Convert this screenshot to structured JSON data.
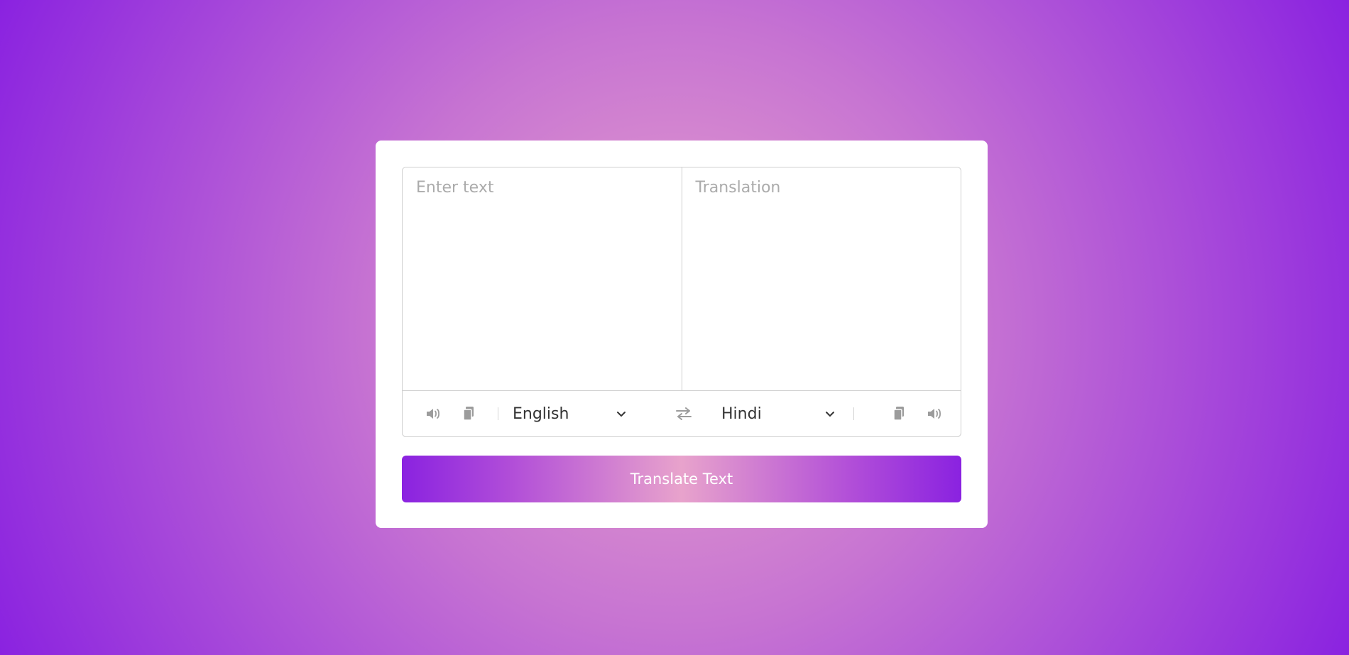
{
  "from_text": {
    "placeholder": "Enter text",
    "value": ""
  },
  "to_text": {
    "placeholder": "Translation",
    "value": ""
  },
  "controls": {
    "from_language": "English",
    "to_language": "Hindi",
    "icons": {
      "speak": "volume-icon",
      "copy": "copy-icon",
      "exchange": "exchange-icon",
      "dropdown": "chevron-down-icon"
    }
  },
  "translate_button": {
    "label": "Translate Text"
  },
  "colors": {
    "accent_start": "#8a22e0",
    "accent_mid": "#e8a3cc",
    "icon_gray": "#9c9c9c"
  }
}
